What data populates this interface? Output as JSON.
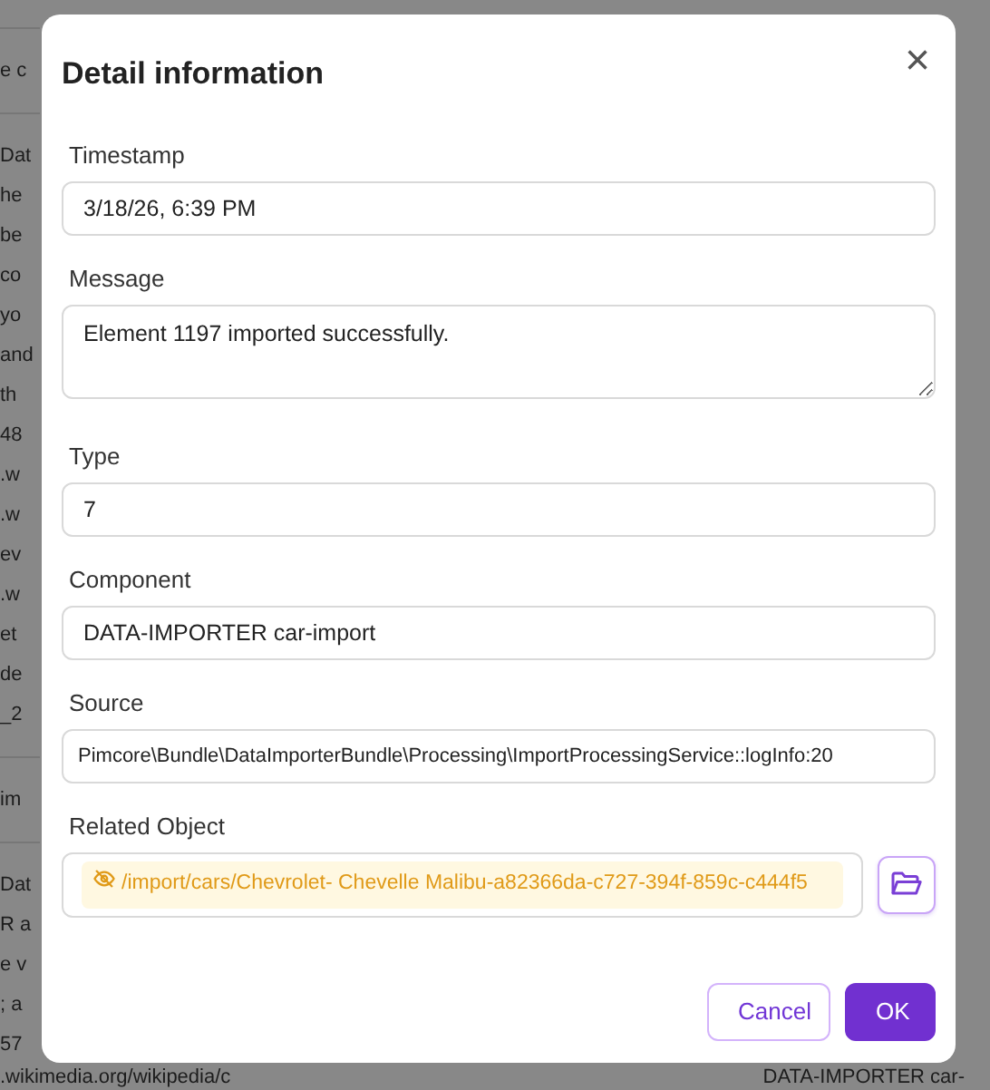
{
  "backdrop": {
    "left_groups": [
      [
        "e c"
      ],
      [
        "Dat",
        "he",
        "be",
        "co",
        "yo",
        "and",
        "th",
        "48",
        ".w",
        ".w",
        "ev",
        ".w",
        "et",
        "de",
        "_2"
      ],
      [
        "im"
      ],
      [
        "Dat",
        "R a",
        "e v",
        "; a",
        "57"
      ]
    ],
    "bottom_row": [
      ".wikimedia.org/wikipedia/c",
      "DATA-IMPORTER car-"
    ]
  },
  "dialog": {
    "title": "Detail information",
    "close": "×",
    "fields": [
      {
        "kind": "input",
        "label": "Timestamp",
        "value": "3/18/26, 6:39 PM"
      },
      {
        "kind": "textarea",
        "label": "Message",
        "value": "Element 1197 imported successfully."
      },
      {
        "kind": "input",
        "label": "Type",
        "value": "7"
      },
      {
        "kind": "input",
        "label": "Component",
        "value": "DATA-IMPORTER car-import"
      },
      {
        "kind": "input",
        "label": "Source",
        "value": "Pimcore\\Bundle\\DataImporterBundle\\Processing\\ImportProcessingService::logInfo:20"
      },
      {
        "kind": "related",
        "label": "Related Object",
        "value": "/import/cars/Chevrolet- Chevelle Malibu-a82366da-c727-394f-859c-c444f5"
      }
    ],
    "buttons": [
      {
        "label": "Cancel",
        "kind": "secondary"
      },
      {
        "label": "OK",
        "kind": "primary"
      }
    ]
  }
}
